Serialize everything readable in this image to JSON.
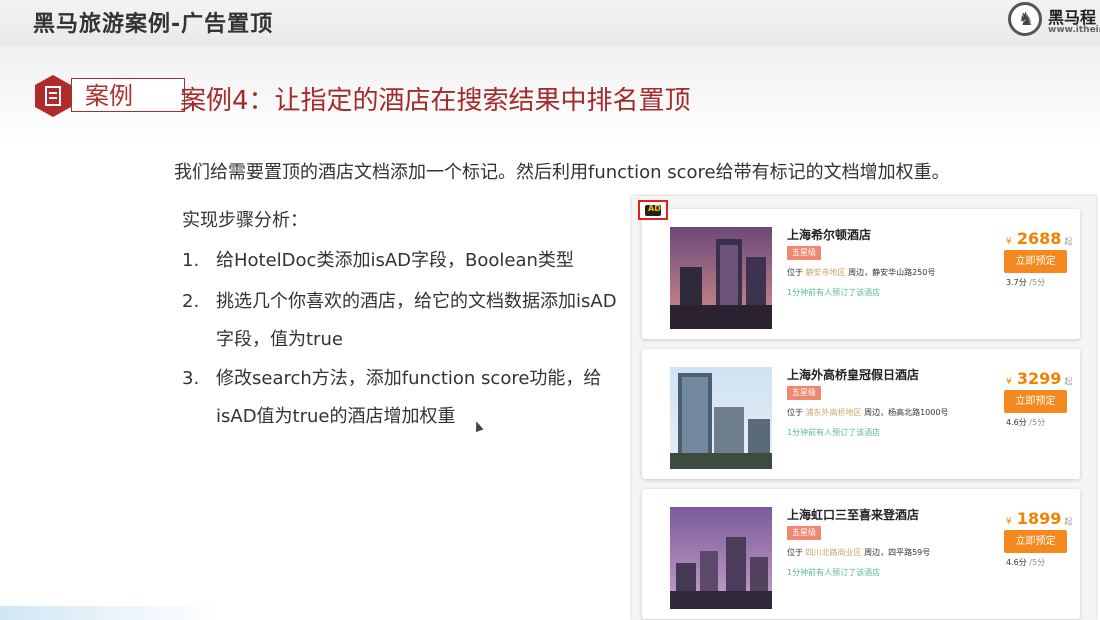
{
  "header": {
    "title": "黑马旅游案例-广告置顶",
    "logo_name": "黑马程",
    "logo_url": "www.itheim"
  },
  "case": {
    "tag": "案例",
    "heading": "案例4：让指定的酒店在搜索结果中排名置顶"
  },
  "intro": "我们给需要置顶的酒店文档添加一个标记。然后利用function score给带有标记的文档增加权重。",
  "steps": {
    "title": "实现步骤分析：",
    "items": [
      {
        "num": "1.",
        "text": "给HotelDoc类添加isAD字段，Boolean类型"
      },
      {
        "num": "2.",
        "text": "挑选几个你喜欢的酒店，给它的文档数据添加isAD字段，值为true"
      },
      {
        "num": "3.",
        "text": "修改search方法，添加function score功能，给isAD值为true的酒店增加权重"
      }
    ]
  },
  "ad_icon": "ad-badge-icon",
  "hotels": [
    {
      "name": "上海希尔顿酒店",
      "star": "五星级",
      "addr_prefix": "位于",
      "area": "静安寺地区",
      "addr_suffix": "周边，静安华山路250号",
      "booked": "1分钟前有人预订了该酒店",
      "currency": "¥",
      "price": "2688",
      "price_unit": "起",
      "book": "立即预定",
      "score": "3.7分",
      "score_of": "/5分"
    },
    {
      "name": "上海外高桥皇冠假日酒店",
      "star": "五星级",
      "addr_prefix": "位于",
      "area": "浦东外高桥地区",
      "addr_suffix": "周边，杨高北路1000号",
      "booked": "1分钟前有人预订了该酒店",
      "currency": "¥",
      "price": "3299",
      "price_unit": "起",
      "book": "立即预定",
      "score": "4.6分",
      "score_of": "/5分"
    },
    {
      "name": "上海虹口三至喜来登酒店",
      "star": "五星级",
      "addr_prefix": "位于",
      "area": "四川北路商业区",
      "addr_suffix": "周边，四平路59号",
      "booked": "1分钟前有人预订了该酒店",
      "currency": "¥",
      "price": "1899",
      "price_unit": "起",
      "book": "立即预定",
      "score": "4.6分",
      "score_of": "/5分"
    }
  ],
  "colors": {
    "accent": "#a52a2a",
    "price": "#f08200",
    "book_button": "#f5891f",
    "ad_frame": "#e0201a"
  }
}
